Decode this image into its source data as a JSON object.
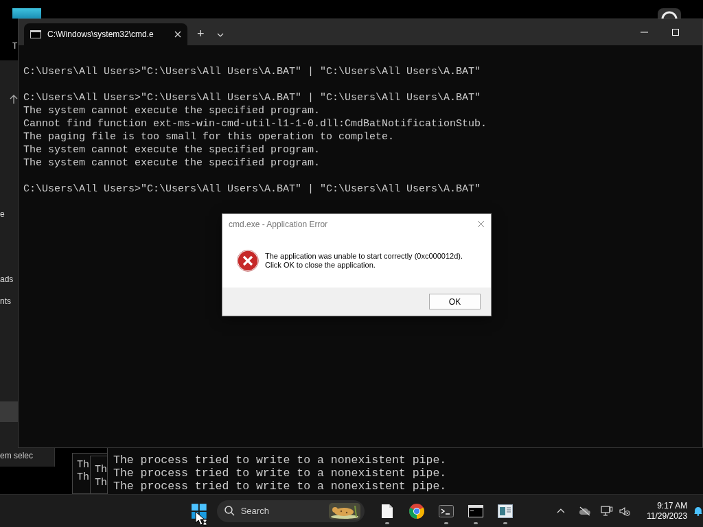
{
  "desktop": {
    "icon_label": "T"
  },
  "explorer": {
    "items": [
      "e",
      "ads",
      "nts"
    ],
    "status": "em selec"
  },
  "back_consoles": [
    {
      "lines": [
        "Th",
        "Th"
      ]
    },
    {
      "lines": [
        "Th",
        "Th"
      ]
    },
    {
      "lines": [
        "The process tried to write to a nonexistent pipe.",
        "The process tried to write to a nonexistent pipe.",
        "The process tried to write to a nonexistent pipe."
      ]
    }
  ],
  "terminal": {
    "tabs": [
      {
        "title": "C:\\Windows\\system32\\cmd.e",
        "selected": true
      }
    ],
    "new_tab": "+",
    "blocks": [
      [
        "C:\\Users\\All Users>\"C:\\Users\\All Users\\A.BAT\" | \"C:\\Users\\All Users\\A.BAT\""
      ],
      [
        "C:\\Users\\All Users>\"C:\\Users\\All Users\\A.BAT\" | \"C:\\Users\\All Users\\A.BAT\"",
        "The system cannot execute the specified program.",
        "Cannot find function ext-ms-win-cmd-util-l1-1-0.dll:CmdBatNotificationStub.",
        "The paging file is too small for this operation to complete.",
        "The system cannot execute the specified program.",
        "The system cannot execute the specified program."
      ],
      [
        "C:\\Users\\All Users>\"C:\\Users\\All Users\\A.BAT\" | \"C:\\Users\\All Users\\A.BAT\""
      ]
    ]
  },
  "dialog": {
    "title": "cmd.exe - Application Error",
    "message_lines": [
      "The application was unable to start correctly (0xc000012d).",
      "Click OK to close the application."
    ],
    "buttons": [
      "OK"
    ]
  },
  "taskbar": {
    "search_placeholder": "Search",
    "apps": [
      {
        "kind": "file",
        "running": true
      },
      {
        "kind": "browser",
        "running": false
      },
      {
        "kind": "terminal",
        "running": true
      },
      {
        "kind": "console",
        "running": true
      },
      {
        "kind": "notepad",
        "running": true
      }
    ],
    "time": "9:17 AM",
    "date": "11/29/2023"
  }
}
